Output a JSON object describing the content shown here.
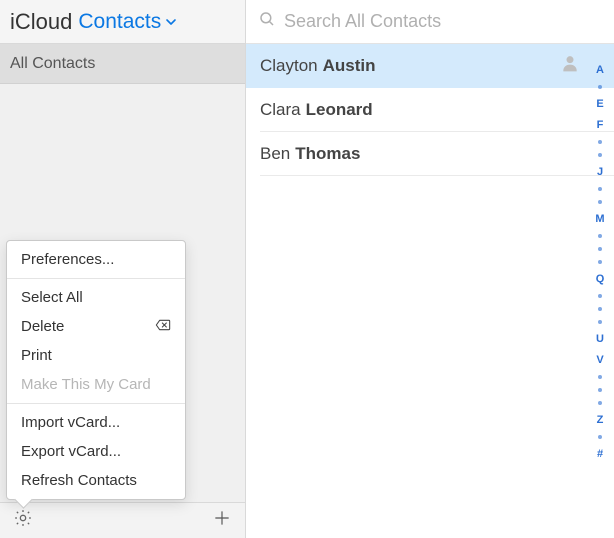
{
  "header": {
    "brand": "iCloud",
    "app_name": "Contacts"
  },
  "sidebar": {
    "group_label": "All Contacts"
  },
  "menu": {
    "items": [
      {
        "label": "Preferences...",
        "disabled": false,
        "icon": ""
      },
      {
        "sep": true
      },
      {
        "label": "Select All",
        "disabled": false,
        "icon": ""
      },
      {
        "label": "Delete",
        "disabled": false,
        "icon": "backspace"
      },
      {
        "label": "Print",
        "disabled": false,
        "icon": ""
      },
      {
        "label": "Make This My Card",
        "disabled": true,
        "icon": ""
      },
      {
        "sep": true
      },
      {
        "label": "Import vCard...",
        "disabled": false,
        "icon": ""
      },
      {
        "label": "Export vCard...",
        "disabled": false,
        "icon": ""
      },
      {
        "label": "Refresh Contacts",
        "disabled": false,
        "icon": ""
      }
    ]
  },
  "search": {
    "placeholder": "Search All Contacts"
  },
  "contacts": [
    {
      "first": "Clayton",
      "last": "Austin",
      "selected": true,
      "avatar": true
    },
    {
      "first": "Clara",
      "last": "Leonard",
      "selected": false,
      "avatar": false
    },
    {
      "first": "Ben",
      "last": "Thomas",
      "selected": false,
      "avatar": false
    }
  ],
  "index_strip": [
    "A",
    "•",
    "E",
    "F",
    "•",
    "•",
    "J",
    "•",
    "•",
    "M",
    "•",
    "•",
    "•",
    "Q",
    "•",
    "•",
    "•",
    "U",
    "V",
    "•",
    "•",
    "•",
    "Z",
    "•",
    "#"
  ]
}
